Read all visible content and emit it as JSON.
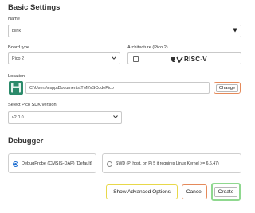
{
  "section_basic": "Basic Settings",
  "name": {
    "label": "Name",
    "value": "blink"
  },
  "board": {
    "label": "Board type",
    "value": "Pico 2"
  },
  "arch": {
    "label": "Architecture (Pico 2)",
    "option": "RISC-V"
  },
  "location": {
    "label": "Location",
    "path": "C:\\Users\\espp\\Documents\\TMI\\VSCodePico",
    "change": "Change"
  },
  "sdk": {
    "label": "Select Pico SDK version",
    "value": "v2.0.0"
  },
  "section_debugger": "Debugger",
  "debug_options": [
    {
      "label": "DebugProbe (CMSIS-DAP) [Default]",
      "selected": true
    },
    {
      "label": "SWD (Pi host, on Pi 5 it requires Linux Kernel >= 6.6.47)",
      "selected": false
    }
  ],
  "footer": {
    "advanced": "Show Advanced Options",
    "cancel": "Cancel",
    "create": "Create"
  },
  "colors": {
    "accent_blue": "#1f6fd1",
    "yellow": "#e8d84a",
    "orange": "#e58a5a",
    "green": "#8fd88f",
    "save_green": "#2b8a6a"
  }
}
